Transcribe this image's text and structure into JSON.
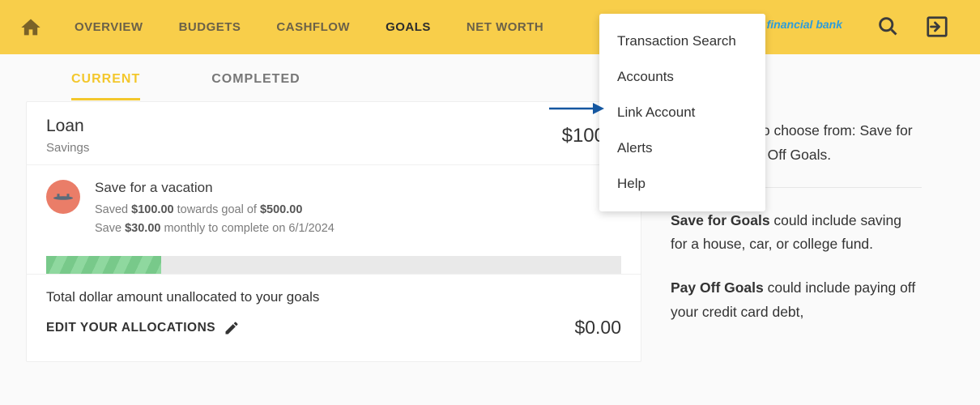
{
  "nav": {
    "items": [
      "OVERVIEW",
      "BUDGETS",
      "CASHFLOW",
      "GOALS",
      "NET WORTH"
    ],
    "active_index": 3
  },
  "brand": "rst financial bank",
  "dropdown": {
    "items": [
      "Transaction Search",
      "Accounts",
      "Link Account",
      "Alerts",
      "Help"
    ]
  },
  "tabs": {
    "items": [
      "CURRENT",
      "COMPLETED"
    ],
    "active_index": 0
  },
  "goal_summary": {
    "title": "Loan",
    "subtitle": "Savings",
    "amount": "$100.0"
  },
  "goal_item": {
    "title": "Save for a vacation",
    "line1_pre": "Saved ",
    "line1_bold1": "$100.00",
    "line1_mid": " towards goal of ",
    "line1_bold2": "$500.00",
    "line2_pre": "Save ",
    "line2_bold": "$30.00",
    "line2_post": " monthly to complete on 6/1/2024",
    "progress_percent": 20
  },
  "footer": {
    "unallocated_label": "Total dollar amount unallocated to your goals",
    "edit_label": "EDIT YOUR ALLOCATIONS",
    "zero": "$0.00"
  },
  "sidebar": {
    "p1_suffix": "ypes of goals to choose from: Save for Goals and Pay Off Goals.",
    "p2_bold": "Save for Goals",
    "p2_rest": " could include saving for a house, car, or college fund.",
    "p3_bold": "Pay Off Goals",
    "p3_rest": " could include paying off your credit card debt,"
  }
}
